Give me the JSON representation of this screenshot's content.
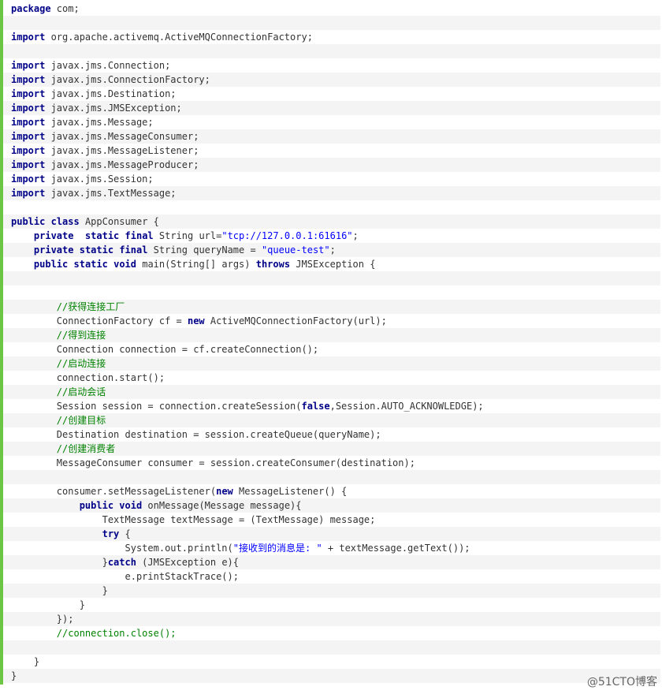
{
  "code": {
    "language": "java",
    "lines": [
      [
        {
          "k": "kw",
          "t": "package"
        },
        {
          "t": " com;"
        }
      ],
      [],
      [
        {
          "k": "kw",
          "t": "import"
        },
        {
          "t": " org.apache.activemq.ActiveMQConnectionFactory;"
        }
      ],
      [],
      [
        {
          "k": "kw",
          "t": "import"
        },
        {
          "t": " javax.jms.Connection;"
        }
      ],
      [
        {
          "k": "kw",
          "t": "import"
        },
        {
          "t": " javax.jms.ConnectionFactory;"
        }
      ],
      [
        {
          "k": "kw",
          "t": "import"
        },
        {
          "t": " javax.jms.Destination;"
        }
      ],
      [
        {
          "k": "kw",
          "t": "import"
        },
        {
          "t": " javax.jms.JMSException;"
        }
      ],
      [
        {
          "k": "kw",
          "t": "import"
        },
        {
          "t": " javax.jms.Message;"
        }
      ],
      [
        {
          "k": "kw",
          "t": "import"
        },
        {
          "t": " javax.jms.MessageConsumer;"
        }
      ],
      [
        {
          "k": "kw",
          "t": "import"
        },
        {
          "t": " javax.jms.MessageListener;"
        }
      ],
      [
        {
          "k": "kw",
          "t": "import"
        },
        {
          "t": " javax.jms.MessageProducer;"
        }
      ],
      [
        {
          "k": "kw",
          "t": "import"
        },
        {
          "t": " javax.jms.Session;"
        }
      ],
      [
        {
          "k": "kw",
          "t": "import"
        },
        {
          "t": " javax.jms.TextMessage;"
        }
      ],
      [],
      [
        {
          "k": "kw",
          "t": "public"
        },
        {
          "t": " "
        },
        {
          "k": "kw",
          "t": "class"
        },
        {
          "t": " AppConsumer {"
        }
      ],
      [
        {
          "t": "    "
        },
        {
          "k": "kw",
          "t": "private"
        },
        {
          "t": "  "
        },
        {
          "k": "kw",
          "t": "static"
        },
        {
          "t": " "
        },
        {
          "k": "kw",
          "t": "final"
        },
        {
          "t": " String url="
        },
        {
          "k": "str",
          "t": "\"tcp://127.0.0.1:61616\""
        },
        {
          "t": ";"
        }
      ],
      [
        {
          "t": "    "
        },
        {
          "k": "kw",
          "t": "private"
        },
        {
          "t": " "
        },
        {
          "k": "kw",
          "t": "static"
        },
        {
          "t": " "
        },
        {
          "k": "kw",
          "t": "final"
        },
        {
          "t": " String queryName = "
        },
        {
          "k": "str",
          "t": "\"queue-test\""
        },
        {
          "t": ";"
        }
      ],
      [
        {
          "t": "    "
        },
        {
          "k": "kw",
          "t": "public"
        },
        {
          "t": " "
        },
        {
          "k": "kw",
          "t": "static"
        },
        {
          "t": " "
        },
        {
          "k": "kw",
          "t": "void"
        },
        {
          "t": " main(String[] args) "
        },
        {
          "k": "kw",
          "t": "throws"
        },
        {
          "t": " JMSException {"
        }
      ],
      [],
      [],
      [
        {
          "t": "        "
        },
        {
          "k": "cm",
          "t": "//获得连接工厂"
        }
      ],
      [
        {
          "t": "        ConnectionFactory cf = "
        },
        {
          "k": "kw",
          "t": "new"
        },
        {
          "t": " ActiveMQConnectionFactory(url);"
        }
      ],
      [
        {
          "t": "        "
        },
        {
          "k": "cm",
          "t": "//得到连接"
        }
      ],
      [
        {
          "t": "        Connection connection = cf.createConnection();"
        }
      ],
      [
        {
          "t": "        "
        },
        {
          "k": "cm",
          "t": "//启动连接"
        }
      ],
      [
        {
          "t": "        connection.start();"
        }
      ],
      [
        {
          "t": "        "
        },
        {
          "k": "cm",
          "t": "//启动会话"
        }
      ],
      [
        {
          "t": "        Session session = connection.createSession("
        },
        {
          "k": "kw",
          "t": "false"
        },
        {
          "t": ",Session.AUTO_ACKNOWLEDGE);"
        }
      ],
      [
        {
          "t": "        "
        },
        {
          "k": "cm",
          "t": "//创建目标"
        }
      ],
      [
        {
          "t": "        Destination destination = session.createQueue(queryName);"
        }
      ],
      [
        {
          "t": "        "
        },
        {
          "k": "cm",
          "t": "//创建消费者"
        }
      ],
      [
        {
          "t": "        MessageConsumer consumer = session.createConsumer(destination);"
        }
      ],
      [],
      [
        {
          "t": "        consumer.setMessageListener("
        },
        {
          "k": "kw",
          "t": "new"
        },
        {
          "t": " MessageListener() {"
        }
      ],
      [
        {
          "t": "            "
        },
        {
          "k": "kw",
          "t": "public"
        },
        {
          "t": " "
        },
        {
          "k": "kw",
          "t": "void"
        },
        {
          "t": " onMessage(Message message){"
        }
      ],
      [
        {
          "t": "                TextMessage textMessage = (TextMessage) message;"
        }
      ],
      [
        {
          "t": "                "
        },
        {
          "k": "kw",
          "t": "try"
        },
        {
          "t": " {"
        }
      ],
      [
        {
          "t": "                    System.out.println("
        },
        {
          "k": "str",
          "t": "\"接收到的消息是: \""
        },
        {
          "t": " + textMessage.getText());"
        }
      ],
      [
        {
          "t": "                }"
        },
        {
          "k": "kw",
          "t": "catch"
        },
        {
          "t": " (JMSException e){"
        }
      ],
      [
        {
          "t": "                    e.printStackTrace();"
        }
      ],
      [
        {
          "t": "                }"
        }
      ],
      [
        {
          "t": "            }"
        }
      ],
      [
        {
          "t": "        });"
        }
      ],
      [
        {
          "t": "        "
        },
        {
          "k": "cm",
          "t": "//connection.close();"
        }
      ],
      [],
      [
        {
          "t": "    }"
        }
      ],
      [
        {
          "t": "}"
        }
      ]
    ]
  },
  "watermark": "@51CTO博客",
  "colors": {
    "gutter": "#6cc644",
    "keyword": "#000088",
    "string": "#0000ff",
    "comment": "#008200",
    "text": "#333333",
    "stripe": "#f4f4f4"
  }
}
